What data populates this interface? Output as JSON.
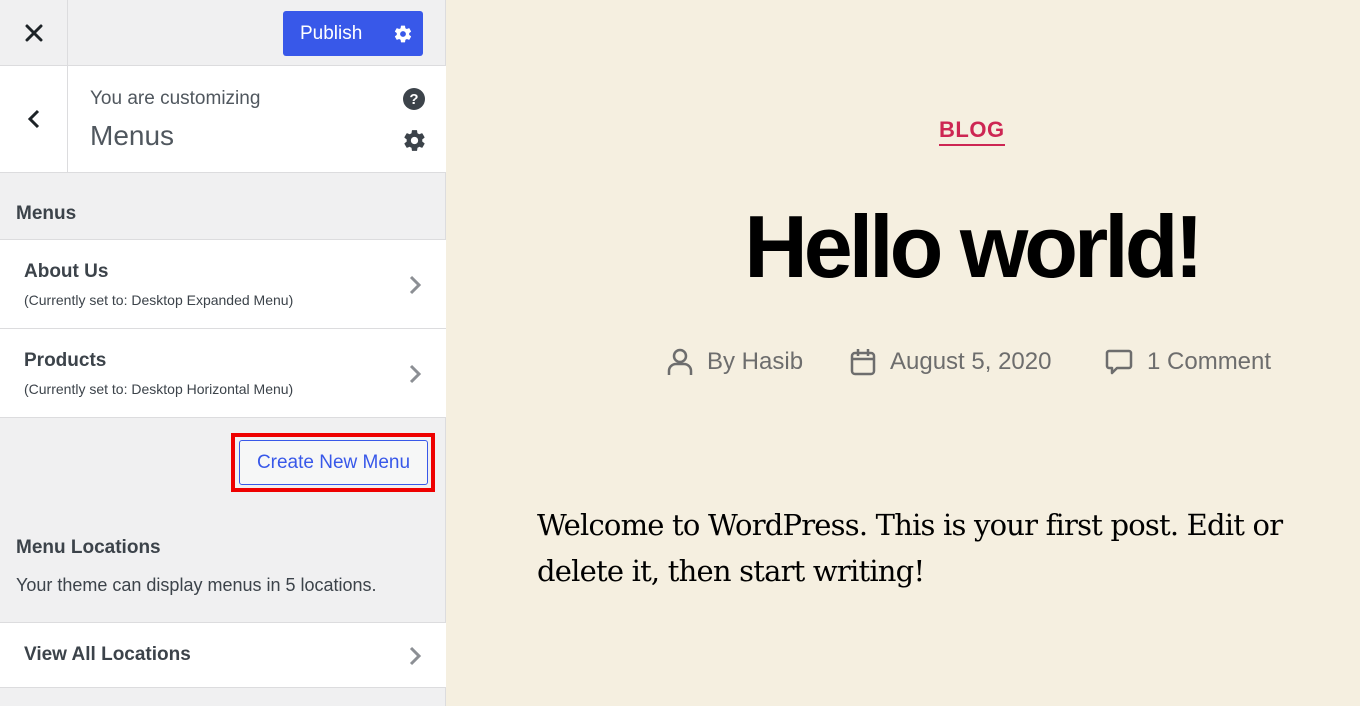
{
  "topbar": {
    "close_icon": "close-icon",
    "publish_label": "Publish",
    "publish_settings_icon": "gear-icon",
    "publish_color": "#3858e9"
  },
  "section_header": {
    "back_icon": "chevron-left-icon",
    "customizing_label": "You are customizing",
    "title": "Menus",
    "help_icon": "help-icon",
    "settings_icon": "gear-icon"
  },
  "menus": {
    "heading": "Menus",
    "items": [
      {
        "name": "About Us",
        "assignment": "(Currently set to: Desktop Expanded Menu)"
      },
      {
        "name": "Products",
        "assignment": "(Currently set to: Desktop Horizontal Menu)"
      }
    ],
    "create_button": "Create New Menu"
  },
  "locations": {
    "heading": "Menu Locations",
    "description": "Your theme can display menus in 5 locations.",
    "view_all": "View All Locations"
  },
  "preview": {
    "category": "BLOG",
    "category_color": "#cd2653",
    "title": "Hello world!",
    "author": "By Hasib",
    "date": "August 5, 2020",
    "comments": "1 Comment",
    "body": "Welcome to WordPress. This is your first post. Edit or delete it, then start writing!"
  }
}
